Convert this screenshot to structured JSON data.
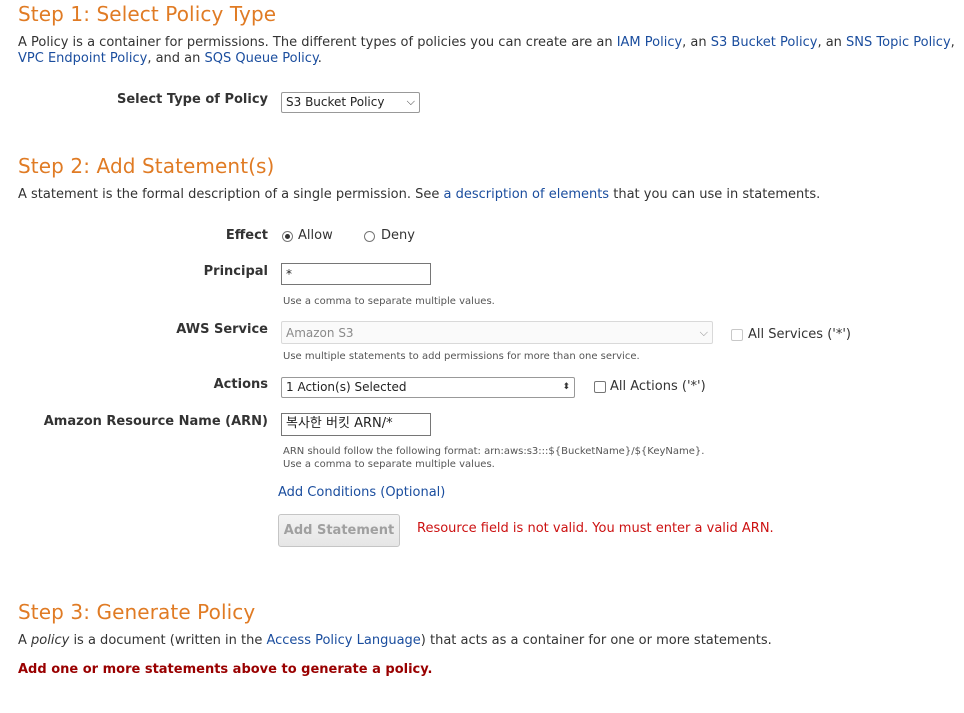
{
  "step1": {
    "title": "Step 1: Select Policy Type",
    "desc_prefix": "A Policy is a container for permissions. The different types of policies you can create are an ",
    "link_iam": "IAM Policy",
    "sep1": ", an ",
    "link_s3": "S3 Bucket Policy",
    "sep2": ", an ",
    "link_sns": "SNS Topic Policy",
    "sep3": ",",
    "link_vpc": "VPC Endpoint Policy",
    "sep4": ", and an ",
    "link_sqs": "SQS Queue Policy",
    "sep5": ".",
    "type_label": "Select Type of Policy",
    "type_value": "S3 Bucket Policy"
  },
  "step2": {
    "title": "Step 2: Add Statement(s)",
    "desc_prefix": "A statement is the formal description of a single permission. See ",
    "desc_link": "a description of elements",
    "desc_suffix": " that you can use in statements.",
    "effect_label": "Effect",
    "effect_allow": "Allow",
    "effect_deny": "Deny",
    "principal_label": "Principal",
    "principal_value": "*",
    "principal_hint": "Use a comma to separate multiple values.",
    "service_label": "AWS Service",
    "service_value": "Amazon S3",
    "all_services_label": "All Services ('*')",
    "service_hint": "Use multiple statements to add permissions for more than one service.",
    "actions_label": "Actions",
    "actions_value": "1 Action(s) Selected",
    "all_actions_label": "All Actions ('*')",
    "arn_label": "Amazon Resource Name (ARN)",
    "arn_value": "복사한 버킷 ARN/*",
    "arn_hint_1": "ARN should follow the following format: arn:aws:s3:::${BucketName}/${KeyName}.",
    "arn_hint_2": "Use a comma to separate multiple values.",
    "add_conditions": "Add Conditions (Optional)",
    "add_statement": "Add Statement",
    "error": "Resource field is not valid. You must enter a valid ARN."
  },
  "step3": {
    "title": "Step 3: Generate Policy",
    "desc_a": "A ",
    "desc_policy": "policy",
    "desc_b": " is a document (written in the ",
    "desc_link": "Access Policy Language",
    "desc_c": ") that acts as a container for one or more statements.",
    "message": "Add one or more statements above to generate a policy."
  },
  "colors": {
    "heading": "#e07b24",
    "link": "#1a4d9e",
    "error": "#cc1111",
    "generate_message": "#990000"
  }
}
